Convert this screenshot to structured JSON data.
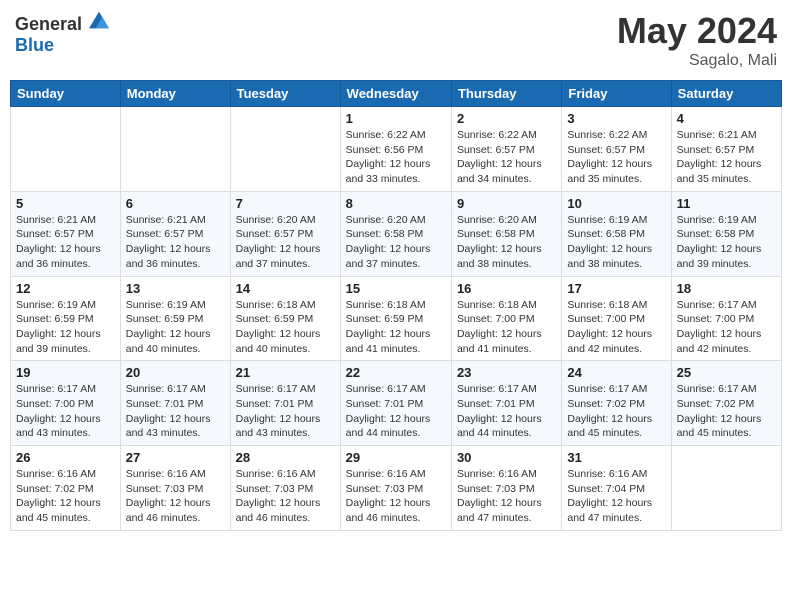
{
  "header": {
    "logo_general": "General",
    "logo_blue": "Blue",
    "month_title": "May 2024",
    "location": "Sagalo, Mali"
  },
  "weekdays": [
    "Sunday",
    "Monday",
    "Tuesday",
    "Wednesday",
    "Thursday",
    "Friday",
    "Saturday"
  ],
  "weeks": [
    [
      {
        "day": "",
        "info": ""
      },
      {
        "day": "",
        "info": ""
      },
      {
        "day": "",
        "info": ""
      },
      {
        "day": "1",
        "info": "Sunrise: 6:22 AM\nSunset: 6:56 PM\nDaylight: 12 hours\nand 33 minutes."
      },
      {
        "day": "2",
        "info": "Sunrise: 6:22 AM\nSunset: 6:57 PM\nDaylight: 12 hours\nand 34 minutes."
      },
      {
        "day": "3",
        "info": "Sunrise: 6:22 AM\nSunset: 6:57 PM\nDaylight: 12 hours\nand 35 minutes."
      },
      {
        "day": "4",
        "info": "Sunrise: 6:21 AM\nSunset: 6:57 PM\nDaylight: 12 hours\nand 35 minutes."
      }
    ],
    [
      {
        "day": "5",
        "info": "Sunrise: 6:21 AM\nSunset: 6:57 PM\nDaylight: 12 hours\nand 36 minutes."
      },
      {
        "day": "6",
        "info": "Sunrise: 6:21 AM\nSunset: 6:57 PM\nDaylight: 12 hours\nand 36 minutes."
      },
      {
        "day": "7",
        "info": "Sunrise: 6:20 AM\nSunset: 6:57 PM\nDaylight: 12 hours\nand 37 minutes."
      },
      {
        "day": "8",
        "info": "Sunrise: 6:20 AM\nSunset: 6:58 PM\nDaylight: 12 hours\nand 37 minutes."
      },
      {
        "day": "9",
        "info": "Sunrise: 6:20 AM\nSunset: 6:58 PM\nDaylight: 12 hours\nand 38 minutes."
      },
      {
        "day": "10",
        "info": "Sunrise: 6:19 AM\nSunset: 6:58 PM\nDaylight: 12 hours\nand 38 minutes."
      },
      {
        "day": "11",
        "info": "Sunrise: 6:19 AM\nSunset: 6:58 PM\nDaylight: 12 hours\nand 39 minutes."
      }
    ],
    [
      {
        "day": "12",
        "info": "Sunrise: 6:19 AM\nSunset: 6:59 PM\nDaylight: 12 hours\nand 39 minutes."
      },
      {
        "day": "13",
        "info": "Sunrise: 6:19 AM\nSunset: 6:59 PM\nDaylight: 12 hours\nand 40 minutes."
      },
      {
        "day": "14",
        "info": "Sunrise: 6:18 AM\nSunset: 6:59 PM\nDaylight: 12 hours\nand 40 minutes."
      },
      {
        "day": "15",
        "info": "Sunrise: 6:18 AM\nSunset: 6:59 PM\nDaylight: 12 hours\nand 41 minutes."
      },
      {
        "day": "16",
        "info": "Sunrise: 6:18 AM\nSunset: 7:00 PM\nDaylight: 12 hours\nand 41 minutes."
      },
      {
        "day": "17",
        "info": "Sunrise: 6:18 AM\nSunset: 7:00 PM\nDaylight: 12 hours\nand 42 minutes."
      },
      {
        "day": "18",
        "info": "Sunrise: 6:17 AM\nSunset: 7:00 PM\nDaylight: 12 hours\nand 42 minutes."
      }
    ],
    [
      {
        "day": "19",
        "info": "Sunrise: 6:17 AM\nSunset: 7:00 PM\nDaylight: 12 hours\nand 43 minutes."
      },
      {
        "day": "20",
        "info": "Sunrise: 6:17 AM\nSunset: 7:01 PM\nDaylight: 12 hours\nand 43 minutes."
      },
      {
        "day": "21",
        "info": "Sunrise: 6:17 AM\nSunset: 7:01 PM\nDaylight: 12 hours\nand 43 minutes."
      },
      {
        "day": "22",
        "info": "Sunrise: 6:17 AM\nSunset: 7:01 PM\nDaylight: 12 hours\nand 44 minutes."
      },
      {
        "day": "23",
        "info": "Sunrise: 6:17 AM\nSunset: 7:01 PM\nDaylight: 12 hours\nand 44 minutes."
      },
      {
        "day": "24",
        "info": "Sunrise: 6:17 AM\nSunset: 7:02 PM\nDaylight: 12 hours\nand 45 minutes."
      },
      {
        "day": "25",
        "info": "Sunrise: 6:17 AM\nSunset: 7:02 PM\nDaylight: 12 hours\nand 45 minutes."
      }
    ],
    [
      {
        "day": "26",
        "info": "Sunrise: 6:16 AM\nSunset: 7:02 PM\nDaylight: 12 hours\nand 45 minutes."
      },
      {
        "day": "27",
        "info": "Sunrise: 6:16 AM\nSunset: 7:03 PM\nDaylight: 12 hours\nand 46 minutes."
      },
      {
        "day": "28",
        "info": "Sunrise: 6:16 AM\nSunset: 7:03 PM\nDaylight: 12 hours\nand 46 minutes."
      },
      {
        "day": "29",
        "info": "Sunrise: 6:16 AM\nSunset: 7:03 PM\nDaylight: 12 hours\nand 46 minutes."
      },
      {
        "day": "30",
        "info": "Sunrise: 6:16 AM\nSunset: 7:03 PM\nDaylight: 12 hours\nand 47 minutes."
      },
      {
        "day": "31",
        "info": "Sunrise: 6:16 AM\nSunset: 7:04 PM\nDaylight: 12 hours\nand 47 minutes."
      },
      {
        "day": "",
        "info": ""
      }
    ]
  ]
}
